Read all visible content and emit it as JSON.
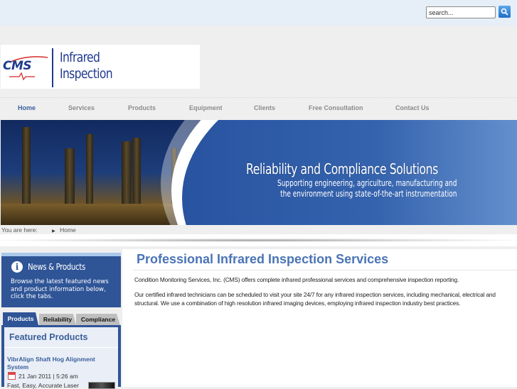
{
  "search": {
    "placeholder": "search...",
    "value": "search...",
    "button_icon": "search-icon"
  },
  "logo": {
    "mark": "CMS",
    "line1": "Infrared",
    "line2": "Inspection"
  },
  "nav": {
    "items": [
      {
        "label": "Home",
        "active": true
      },
      {
        "label": "Services"
      },
      {
        "label": "Products"
      },
      {
        "label": "Equipment"
      },
      {
        "label": "Clients"
      },
      {
        "label": "Free Consultation"
      },
      {
        "label": "Contact Us"
      }
    ]
  },
  "banner": {
    "title": "Reliability and Compliance Solutions",
    "subtitle_line1": "Supporting engineering, agriculture, manufacturing and",
    "subtitle_line2": "the environment using state-of-the-art instrumentation"
  },
  "breadcrumb": {
    "label": "You are here:",
    "items": [
      "Home"
    ]
  },
  "sidebar": {
    "news": {
      "icon": "info-icon",
      "title": "News & Products",
      "description": "Browse the latest featured news and product information below, click the tabs."
    },
    "tabs": [
      {
        "label": "Products",
        "active": true
      },
      {
        "label": "Reliability"
      },
      {
        "label": "Compliance"
      }
    ],
    "featured": {
      "title": "Featured Products",
      "items": [
        {
          "title": "VibrAlign Shaft Hog Alignment System",
          "date": "21 Jan 2011 | 5:26 am",
          "excerpt": "Fast, Easy, Accurate Laser"
        }
      ]
    }
  },
  "main": {
    "title": "Professional Infrared Inspection Services",
    "paragraphs": [
      "Condition Monitoring Services, Inc. (CMS) offers complete infrared professional services and comprehensive inspection reporting.",
      "Our certified infrared technicians can be scheduled to visit your site 24/7 for any infrared inspection services, including mechanical, electrical and structural. We use a combination of high resolution infrared imaging devices, employing infrared inspection industry best practices."
    ]
  }
}
